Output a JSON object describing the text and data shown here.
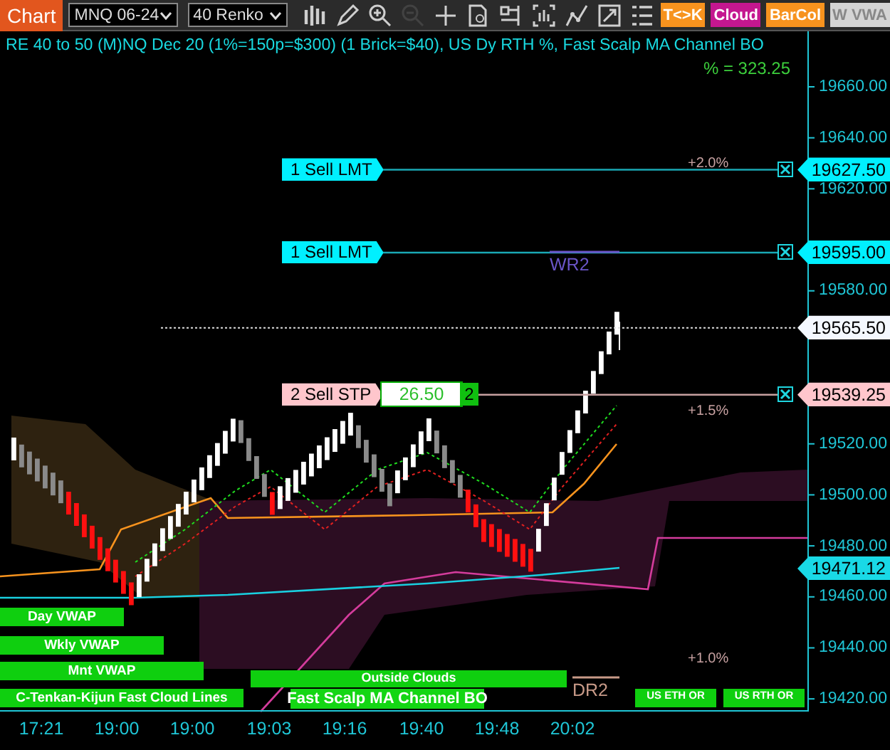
{
  "toolbar": {
    "chart_button": "Chart",
    "instrument": "MNQ 06-24",
    "bar_type": "40 Renko",
    "tools": [
      {
        "kind": "bars",
        "disabled": false
      },
      {
        "kind": "pencil",
        "disabled": false
      },
      {
        "kind": "zoom-in",
        "disabled": false
      },
      {
        "kind": "zoom-out",
        "disabled": true
      },
      {
        "kind": "plus",
        "disabled": false
      },
      {
        "kind": "doc",
        "disabled": false
      },
      {
        "kind": "props",
        "disabled": false
      },
      {
        "kind": "frame",
        "disabled": false
      },
      {
        "kind": "line",
        "disabled": false
      },
      {
        "kind": "export",
        "disabled": false
      },
      {
        "kind": "list",
        "disabled": false
      }
    ],
    "buttons": [
      {
        "label": "T<>K",
        "color": "#f7931e"
      },
      {
        "label": "Cloud",
        "color": "#c4178f"
      },
      {
        "label": "BarCol",
        "color": "#f7931e"
      },
      {
        "label": "W VWA",
        "color": "#d4d4d4"
      }
    ]
  },
  "chart": {
    "title": "RE 40 to 50 (M)NQ Dec 20 (1%=150p=$300) (1 Brick=$40), US Dy RTH %, Fast Scalp MA Channel BO",
    "range_note": "% = 323.25",
    "price_axis": [
      "19660.00",
      "19640.00",
      "19620.00",
      "19580.00",
      "19520.00",
      "19500.00",
      "19480.00",
      "19460.00",
      "19440.00",
      "19420.00"
    ],
    "orders": [
      {
        "label": "1 Sell LMT",
        "kind": "limit",
        "price": "19627.50"
      },
      {
        "label": "1 Sell LMT",
        "kind": "limit",
        "price": "19595.00"
      },
      {
        "label": "2 Sell STP",
        "kind": "stop",
        "price": "19539.25",
        "pnl": "26.50",
        "quantity": "2"
      }
    ],
    "last_price": "19565.50",
    "vwap_price": "19471.12",
    "percent_levels": [
      "+2.0%",
      "+1.5%",
      "+1.0%"
    ],
    "pivots": [
      {
        "label": "WR2",
        "kind": "weekly"
      },
      {
        "label": "DR2",
        "kind": "daily"
      }
    ],
    "indicator_labels": [
      "Day VWAP",
      "Wkly VWAP",
      "Mnt VWAP",
      "C-Tenkan-Kijun Fast Cloud Lines"
    ],
    "zone_label": "Outside Clouds",
    "strategy_label": "Fast Scalp MA Channel BO",
    "session_labels": [
      "US ETH OR",
      "US RTH OR"
    ],
    "time_axis": [
      "17:21",
      "19:00",
      "19:00",
      "19:03",
      "19:16",
      "19:40",
      "19:48",
      "20:02"
    ]
  }
}
